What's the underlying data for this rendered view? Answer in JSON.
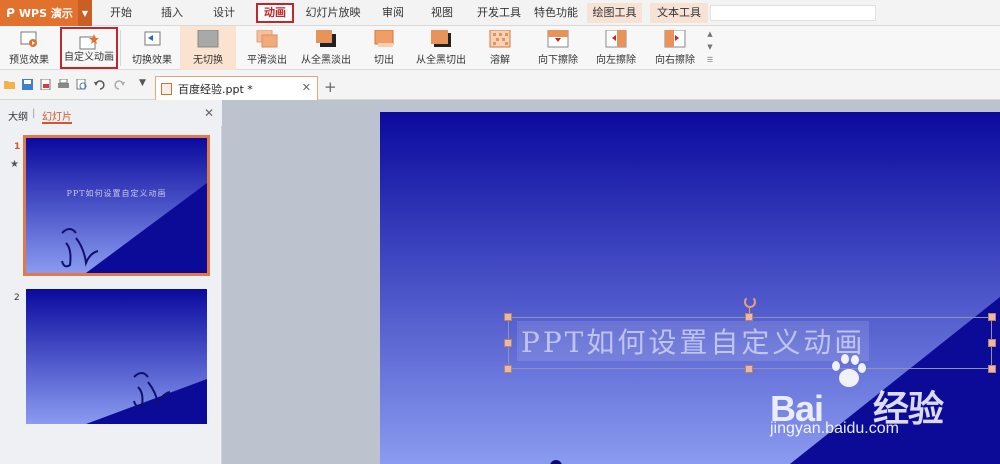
{
  "app": {
    "name": "WPS 演示"
  },
  "menu": {
    "tabs": [
      {
        "label": "开始"
      },
      {
        "label": "插入"
      },
      {
        "label": "设计"
      },
      {
        "label": "动画"
      },
      {
        "label": "幻灯片放映"
      },
      {
        "label": "审阅"
      },
      {
        "label": "视图"
      },
      {
        "label": "开发工具"
      },
      {
        "label": "特色功能"
      },
      {
        "label": "绘图工具"
      },
      {
        "label": "文本工具"
      }
    ],
    "active_tab": "动画"
  },
  "ribbon": {
    "items": [
      {
        "label": "预览效果"
      },
      {
        "label": "自定义动画"
      },
      {
        "label": "切换效果"
      },
      {
        "label": "无切换"
      },
      {
        "label": "平滑淡出"
      },
      {
        "label": "从全黑淡出"
      },
      {
        "label": "切出"
      },
      {
        "label": "从全黑切出"
      },
      {
        "label": "溶解"
      },
      {
        "label": "向下擦除"
      },
      {
        "label": "向左擦除"
      },
      {
        "label": "向右擦除"
      }
    ]
  },
  "document": {
    "tab_title": "百度经验.ppt *"
  },
  "panel": {
    "tab_outline": "大纲",
    "tab_slides": "幻灯片",
    "slides": [
      {
        "number": "1",
        "title": "PPT如何设置自定义动画"
      },
      {
        "number": "2"
      }
    ]
  },
  "slide": {
    "title": "PPT如何设置自定义动画"
  },
  "watermark": {
    "brand": "Bai",
    "brand_after": "经验",
    "url": "jingyan.baidu.com"
  },
  "colors": {
    "accent": "#e2712d",
    "highlight_box": "#c0262c",
    "slide_top": "#0a0a9e",
    "slide_bottom": "#8a9bf0"
  }
}
